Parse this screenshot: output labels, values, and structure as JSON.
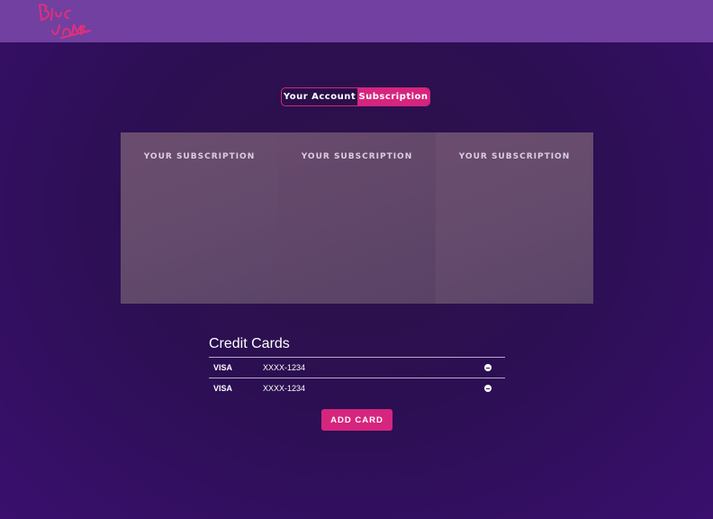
{
  "header": {
    "logo_icon": "blue-james-script-logo",
    "background": "#7140a0"
  },
  "toggle": {
    "tabs": [
      {
        "label": "Your Account",
        "active": false
      },
      {
        "label": "Subscription",
        "active": true
      }
    ],
    "accent": "#d6257e"
  },
  "subscriptions": {
    "panels": [
      {
        "title": "YOUR SUBSCRIPTION"
      },
      {
        "title": "YOUR SUBSCRIPTION"
      },
      {
        "title": "YOUR SUBSCRIPTION"
      }
    ]
  },
  "credit_cards": {
    "heading": "Credit Cards",
    "rows": [
      {
        "brand": "VISA",
        "number": "XXXX-1234",
        "action_icon": "minus-circle-icon"
      },
      {
        "brand": "VISA",
        "number": "XXXX-1234",
        "action_icon": "minus-circle-icon"
      }
    ],
    "add_label": "ADD CARD"
  }
}
